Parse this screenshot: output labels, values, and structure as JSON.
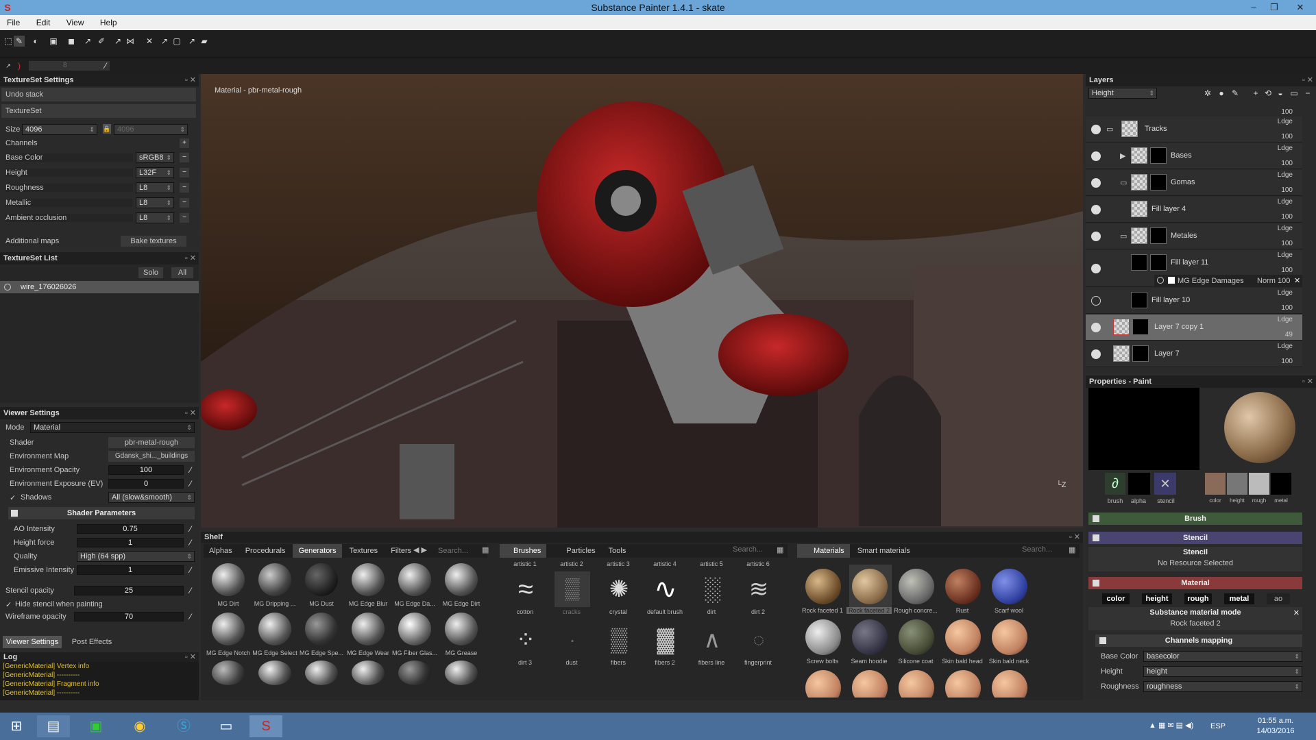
{
  "window": {
    "title": "Substance Painter 1.4.1 - skate",
    "min": "–",
    "restore": "❐",
    "close": "✕"
  },
  "menu": [
    "File",
    "Edit",
    "View",
    "Help"
  ],
  "toolbar_sub": {
    "size_value": "8"
  },
  "texture_settings": {
    "title": "TextureSet Settings",
    "undo": "Undo stack",
    "textureset": "TextureSet",
    "size_label": "Size",
    "size_value": "4096",
    "size_value2": "4096",
    "channels_label": "Channels",
    "channels": [
      {
        "name": "Base Color",
        "format": "sRGB8"
      },
      {
        "name": "Height",
        "format": "L32F"
      },
      {
        "name": "Roughness",
        "format": "L8"
      },
      {
        "name": "Metallic",
        "format": "L8"
      },
      {
        "name": "Ambient occlusion",
        "format": "L8"
      }
    ],
    "additional_maps": "Additional maps",
    "bake": "Bake textures"
  },
  "textureset_list": {
    "title": "TextureSet List",
    "solo": "Solo",
    "all": "All",
    "item": "wire_176026026"
  },
  "viewer": {
    "title": "Viewer Settings",
    "mode_label": "Mode",
    "mode_value": "Material",
    "shader_label": "Shader",
    "shader_value": "pbr-metal-rough",
    "envmap_label": "Environment Map",
    "envmap_value": "Gdansk_shi..._buildings",
    "envop_label": "Environment Opacity",
    "envop_value": "100",
    "envexp_label": "Environment Exposure (EV)",
    "envexp_value": "0",
    "shadows_label": "Shadows",
    "shadows_value": "All (slow&smooth)",
    "shader_params": "Shader Parameters",
    "ao_label": "AO Intensity",
    "ao_value": "0.75",
    "hf_label": "Height force",
    "hf_value": "1",
    "quality_label": "Quality",
    "quality_value": "High (64 spp)",
    "emissive_label": "Emissive Intensity",
    "emissive_value": "1",
    "stencil_label": "Stencil opacity",
    "stencil_value": "25",
    "hide_stencil": "Hide stencil when painting",
    "wire_label": "Wireframe opacity",
    "wire_value": "70",
    "tab1": "Viewer Settings",
    "tab2": "Post Effects"
  },
  "log": {
    "title": "Log",
    "lines": [
      "[GenericMaterial] Vertex info",
      "[GenericMaterial] ----------",
      "[GenericMaterial] Fragment info",
      "[GenericMaterial] ----------"
    ]
  },
  "viewport": {
    "label": "Material - pbr-metal-rough"
  },
  "layers": {
    "title": "Layers",
    "channel": "Height",
    "rows": [
      {
        "name": "Tracks",
        "blend": "Ldge",
        "op": "100"
      },
      {
        "name": "Bases",
        "blend": "Ldge",
        "op": "100"
      },
      {
        "name": "Gomas",
        "blend": "Ldge",
        "op": "100"
      },
      {
        "name": "Fill layer 4",
        "blend": "Ldge",
        "op": "100"
      },
      {
        "name": "Metales",
        "blend": "Ldge",
        "op": "100"
      },
      {
        "name": "Fill layer 11",
        "blend": "Ldge",
        "op": "100"
      },
      {
        "name": "Fill layer 10",
        "blend": "Ldge",
        "op": "100"
      },
      {
        "name": "Layer 7 copy 1",
        "blend": "Ldge",
        "op": "49"
      },
      {
        "name": "Layer 7",
        "blend": "Ldge",
        "op": "100"
      }
    ],
    "top_op": "100",
    "effect": {
      "name": "MG Edge Damages",
      "blend": "Norm",
      "op": "100"
    }
  },
  "properties": {
    "title": "Properties - Paint",
    "brush_lbl": "brush",
    "alpha_lbl": "alpha",
    "stencil_lbl": "stencil",
    "mat_lbls": [
      "color",
      "height",
      "rough",
      "metal"
    ],
    "brush": "Brush",
    "stencil": "Stencil",
    "stencil_sub": "Stencil",
    "no_res": "No Resource Selected",
    "material": "Material",
    "chips": [
      "color",
      "height",
      "rough",
      "metal",
      "ao"
    ],
    "mat_mode": "Substance material mode",
    "mat_name": "Rock faceted 2",
    "channels_mapping": "Channels mapping",
    "maps": [
      {
        "label": "Base Color",
        "value": "basecolor"
      },
      {
        "label": "Height",
        "value": "height"
      },
      {
        "label": "Roughness",
        "value": "roughness"
      }
    ]
  },
  "shelf": {
    "title": "Shelf",
    "tabs_left": [
      "Alphas",
      "Procedurals",
      "Generators",
      "Textures",
      "Filters"
    ],
    "search": "Search...",
    "generators": [
      "MG Dirt",
      "MG Dripping ...",
      "MG Dust",
      "MG Edge Blur",
      "MG Edge Da...",
      "MG Edge Dirt",
      "MG Edge Notch",
      "MG Edge Select",
      "MG Edge Spe...",
      "MG Edge Wear",
      "MG Fiber Glas...",
      "MG Grease"
    ],
    "tabs_mid": [
      "Brushes",
      "Particles",
      "Tools"
    ],
    "brush_top": [
      "artistic 1",
      "artistic 2",
      "artistic 3",
      "artistic 4",
      "artistic 5",
      "artistic 6"
    ],
    "brushes": [
      "cotton",
      "cracks",
      "crystal",
      "default brush",
      "dirt",
      "dirt 2",
      "dirt 3",
      "dust",
      "fibers",
      "fibers 2",
      "fibers line",
      "fingerprint"
    ],
    "tabs_right": [
      "Materials",
      "Smart materials"
    ],
    "materials": [
      "Rock faceted 1",
      "Rock faceted 2",
      "Rough concre...",
      "Rust",
      "Scarf wool",
      "Screw bolts",
      "Seam hoodie",
      "Silicone coat",
      "Skin bald head",
      "Skin bald neck"
    ]
  },
  "taskbar": {
    "clock": "01:55 a.m.",
    "date": "14/03/2016",
    "lang": "ESP"
  }
}
